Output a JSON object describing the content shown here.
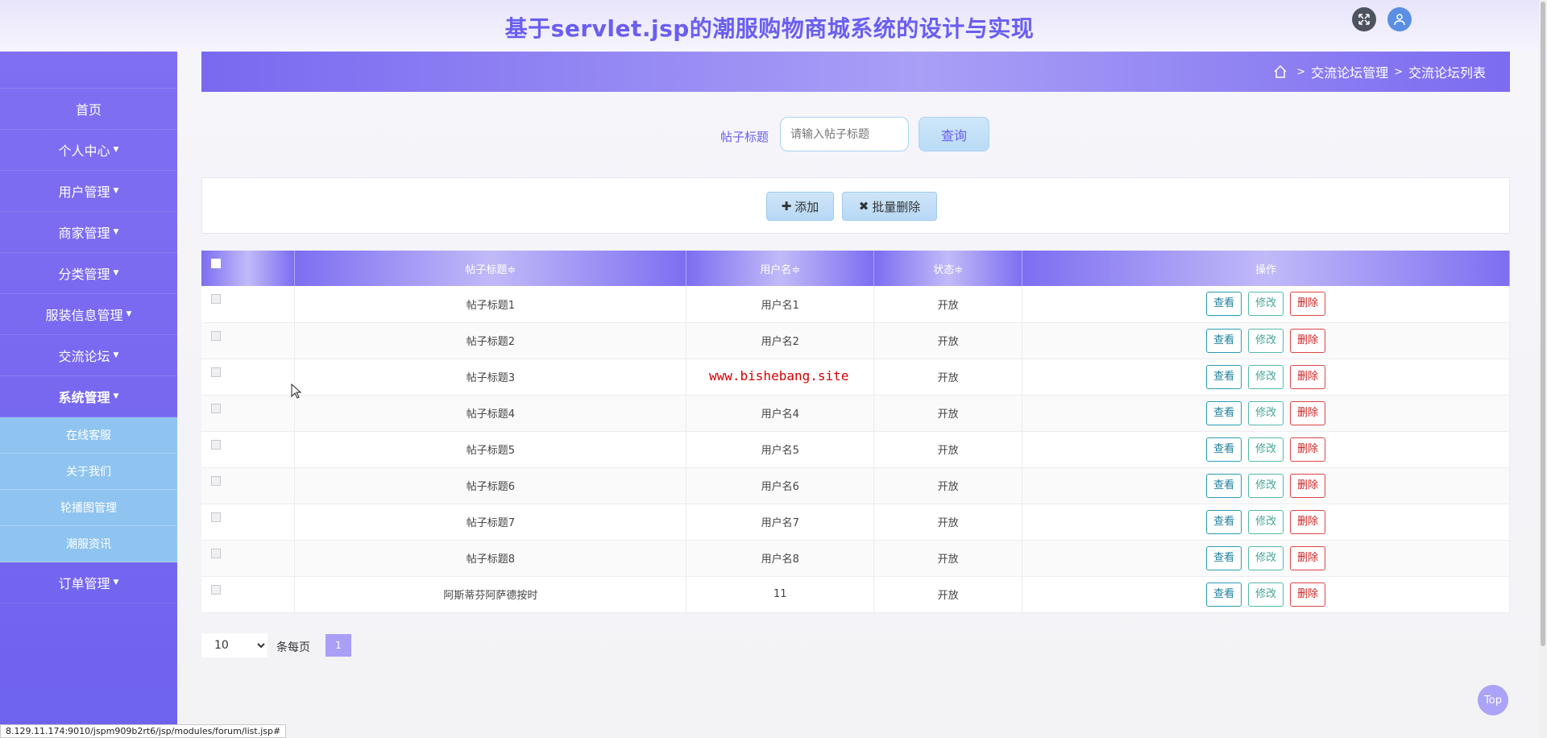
{
  "header": {
    "title": "基于servlet.jsp的潮服购物商城系统的设计与实现"
  },
  "sidebar": {
    "items": [
      {
        "label": "首页"
      },
      {
        "label": "个人中心"
      },
      {
        "label": "用户管理"
      },
      {
        "label": "商家管理"
      },
      {
        "label": "分类管理"
      },
      {
        "label": "服装信息管理"
      },
      {
        "label": "交流论坛"
      },
      {
        "label": "系统管理"
      },
      {
        "label": "订单管理"
      }
    ],
    "submenu": [
      {
        "label": "在线客服"
      },
      {
        "label": "关于我们"
      },
      {
        "label": "轮播图管理"
      },
      {
        "label": "潮服资讯"
      }
    ]
  },
  "breadcrumb": {
    "level1": "交流论坛管理",
    "level2": "交流论坛列表",
    "separator": ">"
  },
  "search": {
    "label": "帖子标题",
    "placeholder": "请输入帖子标题",
    "button": "查询"
  },
  "toolbar": {
    "add": "添加",
    "batch_delete": "批量删除"
  },
  "table": {
    "headers": {
      "title": "帖子标题",
      "username": "用户名",
      "status": "状态",
      "actions": "操作",
      "sort_mark": "≑"
    },
    "rows": [
      {
        "title": "帖子标题1",
        "username": "用户名1",
        "status": "开放"
      },
      {
        "title": "帖子标题2",
        "username": "用户名2",
        "status": "开放"
      },
      {
        "title": "帖子标题3",
        "username": "",
        "status": "开放"
      },
      {
        "title": "帖子标题4",
        "username": "用户名4",
        "status": "开放"
      },
      {
        "title": "帖子标题5",
        "username": "用户名5",
        "status": "开放"
      },
      {
        "title": "帖子标题6",
        "username": "用户名6",
        "status": "开放"
      },
      {
        "title": "帖子标题7",
        "username": "用户名7",
        "status": "开放"
      },
      {
        "title": "帖子标题8",
        "username": "用户名8",
        "status": "开放"
      },
      {
        "title": "阿斯蒂芬阿萨德按时",
        "username": "11",
        "status": "开放"
      }
    ],
    "actions": {
      "view": "查看",
      "edit": "修改",
      "delete": "删除"
    }
  },
  "pagination": {
    "page_size": "10",
    "per_page_label": "条每页",
    "current_page": "1"
  },
  "watermark": "www.bishebang.site",
  "top_button": "Top",
  "status_url": "8.129.11.174:9010/jspm909b2rt6/jsp/modules/forum/list.jsp#",
  "colors": {
    "accent": "#6a5ef0",
    "sidebar": "#7667f0",
    "submenu": "#8fc4f0",
    "delete": "#cc2222"
  }
}
